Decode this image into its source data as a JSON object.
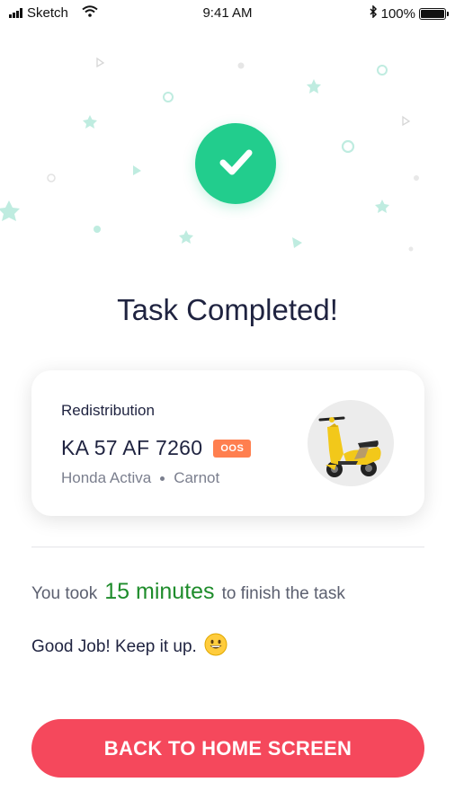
{
  "status_bar": {
    "carrier": "Sketch",
    "time": "9:41 AM",
    "battery": "100%"
  },
  "icons": {
    "signal": "signal-icon",
    "wifi": "wifi-icon",
    "bluetooth": "bluetooth-icon",
    "battery": "battery-icon",
    "success": "checkmark-icon",
    "vehicle": "scooter-icon",
    "emoji": "grinning-face-icon"
  },
  "title": "Task Completed!",
  "task_card": {
    "type": "Redistribution",
    "plate": "KA 57 AF 7260",
    "badge": "OOS",
    "model": "Honda Activa",
    "location": "Carnot"
  },
  "summary": {
    "prefix": "You took",
    "duration": "15 minutes",
    "suffix": "to finish the task"
  },
  "praise": "Good Job! Keep it up.",
  "cta": {
    "label": "BACK TO HOME SCREEN"
  },
  "colors": {
    "success_green": "#22cd8d",
    "duration_green": "#1e8c2b",
    "badge_orange": "#ff7f4f",
    "cta_red": "#f5485c",
    "confetti": "#bfece0"
  }
}
